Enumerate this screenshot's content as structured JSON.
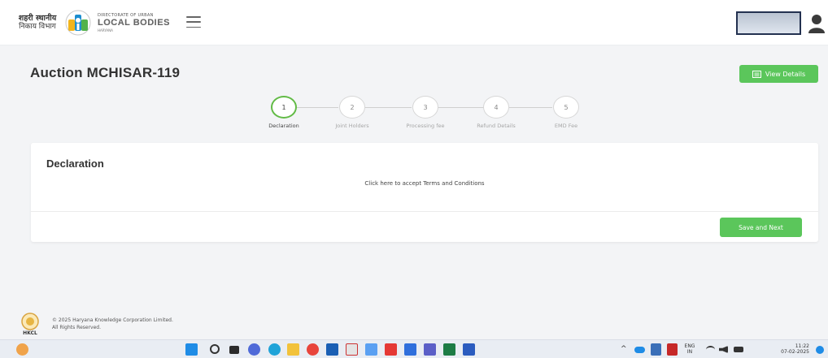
{
  "header": {
    "logo_hindi_line1": "शहरी स्थानीय",
    "logo_hindi_line2": "निकाय विभाग",
    "logo_small": "DIRECTORATE OF URBAN",
    "logo_big": "LOCAL BODIES",
    "logo_sub": "HARYANA"
  },
  "page": {
    "title": "Auction MCHISAR-119",
    "view_details_label": "View Details"
  },
  "stepper": {
    "steps": [
      {
        "number": "1",
        "label": "Declaration",
        "active": true
      },
      {
        "number": "2",
        "label": "Joint Holders",
        "active": false
      },
      {
        "number": "3",
        "label": "Processing fee",
        "active": false
      },
      {
        "number": "4",
        "label": "Refund Details",
        "active": false
      },
      {
        "number": "5",
        "label": "EMD Fee",
        "active": false
      }
    ]
  },
  "card": {
    "title": "Declaration",
    "terms_link": "Click here to accept Terms and Conditions",
    "save_label": "Save and Next"
  },
  "footer": {
    "logo_text": "HKCL",
    "line1": "© 2025 Haryana Knowledge Corporation Limited.",
    "line2": "All Rights Reserved."
  },
  "taskbar": {
    "lang_line1": "ENG",
    "lang_line2": "IN",
    "time": "11:22",
    "date": "07-02-2025"
  },
  "colors": {
    "accent_green": "#5bc65b",
    "step_active_border": "#62bb46",
    "page_bg": "#f3f4f6"
  }
}
